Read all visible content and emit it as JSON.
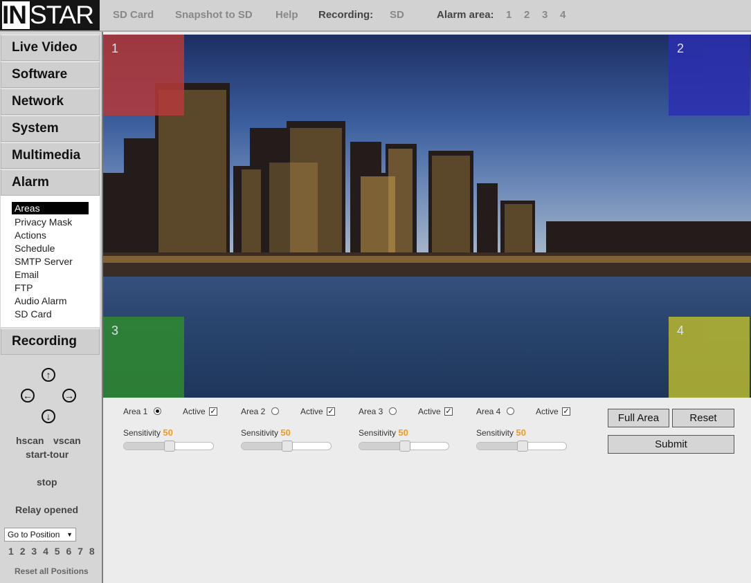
{
  "logo": {
    "part1": "IN",
    "part2": "STAR"
  },
  "topbar": {
    "sd_card": "SD Card",
    "snapshot": "Snapshot to SD",
    "help": "Help",
    "recording_label": "Recording:",
    "recording_value": "SD",
    "alarm_area_label": "Alarm area:",
    "alarm_areas": [
      "1",
      "2",
      "3",
      "4"
    ]
  },
  "sidebar": {
    "nav": [
      "Live Video",
      "Software",
      "Network",
      "System",
      "Multimedia",
      "Alarm",
      "Recording"
    ],
    "submenu": [
      "Areas",
      "Privacy Mask",
      "Actions",
      "Schedule",
      "SMTP Server",
      "Email",
      "FTP",
      "Audio Alarm",
      "SD Card"
    ],
    "selected_submenu": "Areas",
    "hscan": "hscan",
    "vscan": "vscan",
    "start_tour": "start-tour",
    "stop": "stop",
    "relay": "Relay opened",
    "goto_position": "Go to Position",
    "positions": [
      "1",
      "2",
      "3",
      "4",
      "5",
      "6",
      "7",
      "8"
    ],
    "reset_positions": "Reset all Positions"
  },
  "video": {
    "area_labels": [
      "1",
      "2",
      "3",
      "4"
    ],
    "colors": {
      "area1": "#b53a3a",
      "area2": "#2b2fb0",
      "area3": "#2f8a2f",
      "area4": "#b9b82e"
    }
  },
  "areas": [
    {
      "label": "Area 1",
      "selected": true,
      "active_label": "Active",
      "active": true,
      "sensitivity_label": "Sensitivity",
      "sensitivity": "50"
    },
    {
      "label": "Area 2",
      "selected": false,
      "active_label": "Active",
      "active": true,
      "sensitivity_label": "Sensitivity",
      "sensitivity": "50"
    },
    {
      "label": "Area 3",
      "selected": false,
      "active_label": "Active",
      "active": true,
      "sensitivity_label": "Sensitivity",
      "sensitivity": "50"
    },
    {
      "label": "Area 4",
      "selected": false,
      "active_label": "Active",
      "active": true,
      "sensitivity_label": "Sensitivity",
      "sensitivity": "50"
    }
  ],
  "buttons": {
    "full_area": "Full Area",
    "reset": "Reset",
    "submit": "Submit"
  }
}
